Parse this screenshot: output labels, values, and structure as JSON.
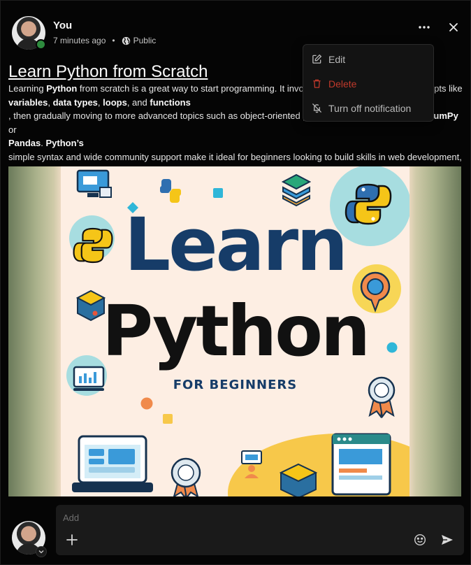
{
  "post": {
    "author": "You",
    "time": "7 minutes ago",
    "separator": "•",
    "visibility": "Public",
    "title": "Learn Python from Scratch",
    "body": {
      "t1": "Learning ",
      "b1": "Python",
      "t2": " from scratch is a great way to start programming. It involves learning fundamental concepts like ",
      "b2": "variables",
      "t3": ", ",
      "b3": "data types",
      "t4": ", ",
      "b4": "loops",
      "t5": ", and ",
      "b5": "functions",
      "t6": ", then gradually moving to more advanced topics such as object-oriented programming and libraries like ",
      "b6": "NumPy",
      "t7": " or ",
      "b7": "Pandas",
      "t8": ". ",
      "b8": "Python’s",
      "t9": " simple syntax and wide community support make it ideal for beginners looking to build skills in web development, data science, automation, or software development."
    },
    "image": {
      "line1": "Learn",
      "line2": "Python",
      "line3": "FOR BEGINNERS"
    }
  },
  "menu": {
    "items": [
      {
        "label": "Edit",
        "icon": "edit-icon"
      },
      {
        "label": "Delete",
        "icon": "trash-icon",
        "color": "#c0392b"
      },
      {
        "label": "Turn off notification",
        "icon": "bell-off-icon"
      }
    ]
  },
  "composer": {
    "placeholder": "Add"
  },
  "colors": {
    "online": "#2e8b3e",
    "title_blue": "#163c68",
    "danger": "#c0392b"
  }
}
